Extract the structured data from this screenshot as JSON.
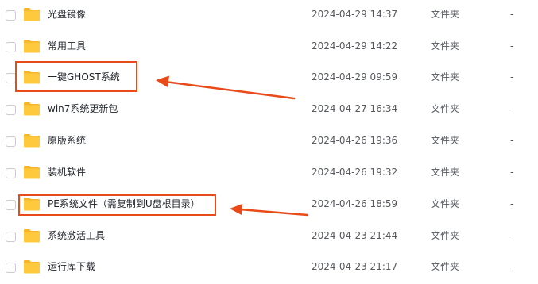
{
  "files": [
    {
      "name": "光盘镜像",
      "modified": "2024-04-29 14:37",
      "type": "文件夹",
      "size": "-"
    },
    {
      "name": "常用工具",
      "modified": "2024-04-29 14:22",
      "type": "文件夹",
      "size": "-"
    },
    {
      "name": "一键GHOST系统",
      "modified": "2024-04-29 09:59",
      "type": "文件夹",
      "size": "-"
    },
    {
      "name": "win7系统更新包",
      "modified": "2024-04-27 16:34",
      "type": "文件夹",
      "size": "-"
    },
    {
      "name": "原版系统",
      "modified": "2024-04-26 19:36",
      "type": "文件夹",
      "size": "-"
    },
    {
      "name": "装机软件",
      "modified": "2024-04-26 19:32",
      "type": "文件夹",
      "size": "-"
    },
    {
      "name": "PE系统文件（需复制到U盘根目录）",
      "modified": "2024-04-26 18:59",
      "type": "文件夹",
      "size": "-"
    },
    {
      "name": "系统激活工具",
      "modified": "2024-04-23 21:44",
      "type": "文件夹",
      "size": "-"
    },
    {
      "name": "运行库下载",
      "modified": "2024-04-23 21:17",
      "type": "文件夹",
      "size": "-"
    }
  ],
  "icons": {
    "folder": "folder-icon",
    "checkbox": "checkbox-icon",
    "annotation_arrow": "arrow-left-icon"
  },
  "colors": {
    "folder_body": "#FFC93E",
    "folder_tab": "#F7B52A",
    "annotation": "#E84A1A",
    "text_primary": "#1F2329",
    "text_secondary": "#55585E",
    "checkbox_border": "#C9CCD3"
  }
}
